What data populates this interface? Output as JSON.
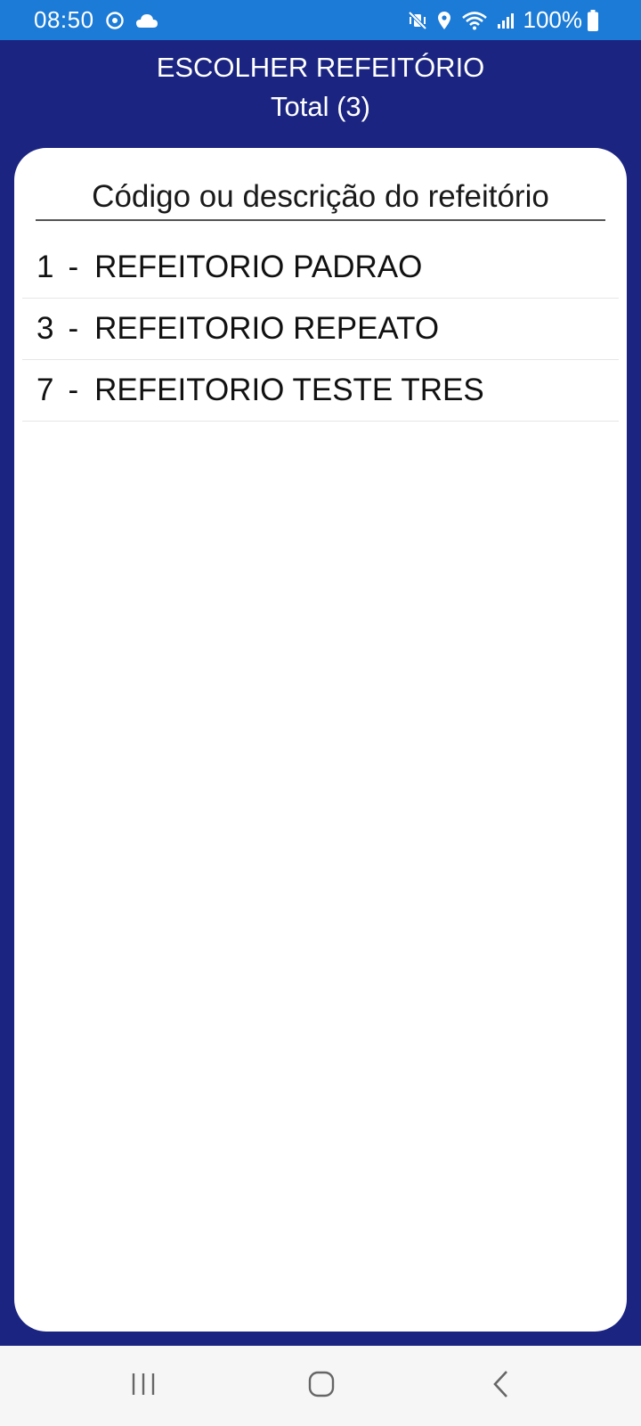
{
  "status_bar": {
    "time": "08:50",
    "battery": "100%",
    "icons": [
      "sync-icon",
      "cloud-icon",
      "mute-vibrate-icon",
      "location-icon",
      "wifi-icon",
      "signal-icon",
      "battery-icon"
    ]
  },
  "header": {
    "title": "ESCOLHER REFEITÓRIO",
    "subtitle": "Total (3)"
  },
  "search": {
    "placeholder": "Código ou descrição do refeitório",
    "value": ""
  },
  "items": [
    {
      "code": "1",
      "separator": "-",
      "name": "REFEITORIO PADRAO"
    },
    {
      "code": "3",
      "separator": "-",
      "name": "REFEITORIO REPEATO"
    },
    {
      "code": "7",
      "separator": "-",
      "name": "REFEITORIO TESTE TRES"
    }
  ],
  "navigation": {
    "buttons": [
      "recent-apps-icon",
      "home-icon",
      "back-icon"
    ]
  },
  "colors": {
    "status_bar": "#1c7bd6",
    "background": "#1b2581",
    "card": "#ffffff",
    "nav_bar": "#f6f6f6"
  }
}
